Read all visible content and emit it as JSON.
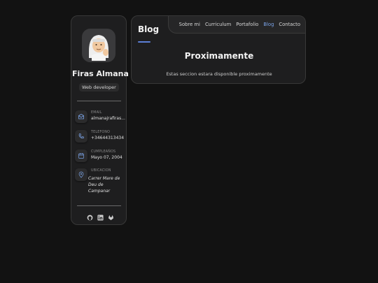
{
  "profile": {
    "name": "Firas Almanajra",
    "role": "Web developer"
  },
  "contacts": [
    {
      "label": "EMAIL",
      "value": "almanajrafiras...",
      "icon": "mail-icon"
    },
    {
      "label": "TELEFONO",
      "value": "+34644313434",
      "icon": "phone-icon"
    },
    {
      "label": "CUMPLEAÑOS",
      "value": "Mayo 07, 2004",
      "icon": "calendar-icon"
    },
    {
      "label": "UBICACION",
      "value": "Carrer Mare de Deu de Campanar",
      "icon": "location-icon"
    }
  ],
  "socials": [
    "github-icon",
    "linkedin-icon",
    "gitlab-icon"
  ],
  "nav": {
    "items": [
      {
        "label": "Sobre mi"
      },
      {
        "label": "Curriculum"
      },
      {
        "label": "Portafolio"
      },
      {
        "label": "Blog"
      },
      {
        "label": "Contacto"
      }
    ],
    "active": "Blog"
  },
  "main": {
    "page_title": "Blog",
    "heading": "Proximamente",
    "message": "Estas seccion estara disponible proximamente"
  },
  "colors": {
    "background": "#121212",
    "card": "#1e1e1f",
    "accent": "#7aa2e6"
  }
}
